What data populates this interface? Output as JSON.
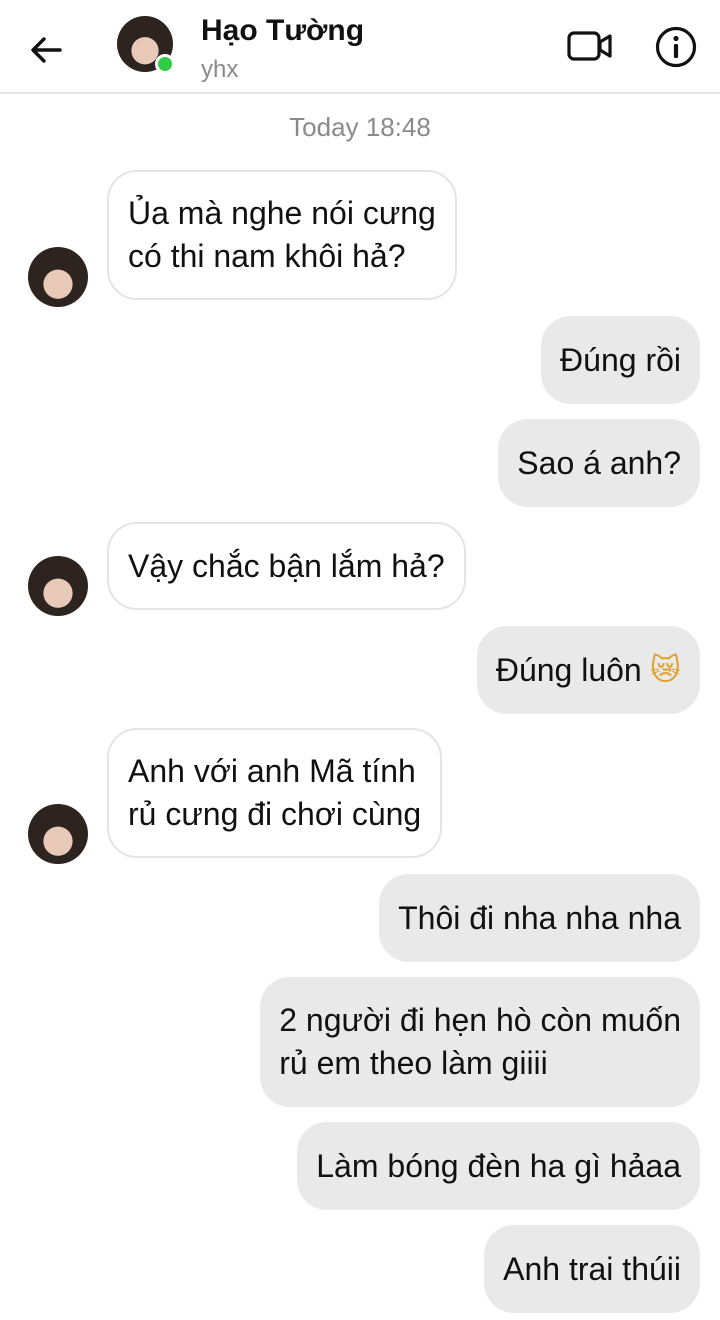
{
  "header": {
    "name": "Hạo Tường",
    "subtitle": "yhx",
    "back_icon": "arrow-left-icon",
    "video_icon": "video-camera-icon",
    "info_icon": "info-circle-icon",
    "online_color": "#31cc46"
  },
  "chat": {
    "timestamp": "Today 18:48",
    "messages": [
      {
        "direction": "in",
        "lines": [
          "Ủa mà nghe nói cưng",
          "có thi nam khôi hả?"
        ]
      },
      {
        "direction": "out",
        "lines": [
          "Đúng rồi"
        ]
      },
      {
        "direction": "out",
        "lines": [
          "Sao á anh?"
        ]
      },
      {
        "direction": "in",
        "lines": [
          "Vậy chắc bận lắm hả?"
        ]
      },
      {
        "direction": "out",
        "lines": [
          "Đúng luôn"
        ],
        "emoji": "😿"
      },
      {
        "direction": "in",
        "lines": [
          "Anh với anh Mã tính",
          "rủ cưng đi chơi cùng"
        ]
      },
      {
        "direction": "out",
        "lines": [
          "Thôi đi nha nha nha"
        ]
      },
      {
        "direction": "out",
        "lines": [
          "2 người đi hẹn hò còn muốn",
          "rủ em theo làm giiii"
        ]
      },
      {
        "direction": "out",
        "lines": [
          "Làm bóng đèn ha gì hảaa"
        ]
      },
      {
        "direction": "out",
        "lines": [
          "Anh trai thúii"
        ]
      }
    ]
  },
  "colors": {
    "incoming_bubble": "#ffffff",
    "outgoing_bubble": "#e9e9e9",
    "muted_text": "#8a8a8a"
  }
}
